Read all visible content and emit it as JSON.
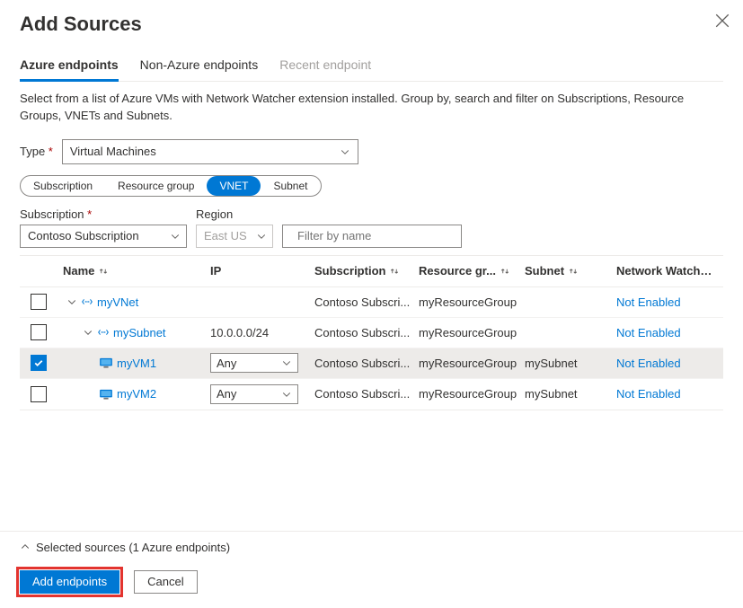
{
  "header": {
    "title": "Add Sources"
  },
  "tabs": {
    "azure": "Azure endpoints",
    "nonazure": "Non-Azure endpoints",
    "recent": "Recent endpoint"
  },
  "description": "Select from a list of Azure VMs with Network Watcher extension installed. Group by, search and filter on Subscriptions, Resource Groups, VNETs and Subnets.",
  "typeField": {
    "label": "Type",
    "value": "Virtual Machines"
  },
  "groupBy": {
    "options": [
      "Subscription",
      "Resource group",
      "VNET",
      "Subnet"
    ],
    "active": "VNET"
  },
  "filters": {
    "subscription": {
      "label": "Subscription",
      "value": "Contoso Subscription"
    },
    "region": {
      "label": "Region",
      "value": "East US"
    },
    "search": {
      "placeholder": "Filter by name"
    }
  },
  "columns": {
    "name": "Name",
    "ip": "IP",
    "subscription": "Subscription",
    "rg": "Resource gr...",
    "subnet": "Subnet",
    "nwe": "Network Watcher Ex..."
  },
  "rows": [
    {
      "kind": "vnet",
      "indent": 0,
      "checked": false,
      "name": "myVNet",
      "ip": "",
      "subscription": "Contoso Subscri...",
      "rg": "myResourceGroup",
      "subnet": "",
      "nwe": "Not Enabled"
    },
    {
      "kind": "subnet",
      "indent": 1,
      "checked": false,
      "name": "mySubnet",
      "ip": "10.0.0.0/24",
      "subscription": "Contoso Subscri...",
      "rg": "myResourceGroup",
      "subnet": "",
      "nwe": "Not Enabled"
    },
    {
      "kind": "vm",
      "indent": 2,
      "checked": true,
      "name": "myVM1",
      "ip": "Any",
      "subscription": "Contoso Subscri...",
      "rg": "myResourceGroup",
      "subnet": "mySubnet",
      "nwe": "Not Enabled"
    },
    {
      "kind": "vm",
      "indent": 2,
      "checked": false,
      "name": "myVM2",
      "ip": "Any",
      "subscription": "Contoso Subscri...",
      "rg": "myResourceGroup",
      "subnet": "mySubnet",
      "nwe": "Not Enabled"
    }
  ],
  "selectedBar": "Selected sources (1 Azure endpoints)",
  "buttons": {
    "primary": "Add endpoints",
    "secondary": "Cancel"
  }
}
